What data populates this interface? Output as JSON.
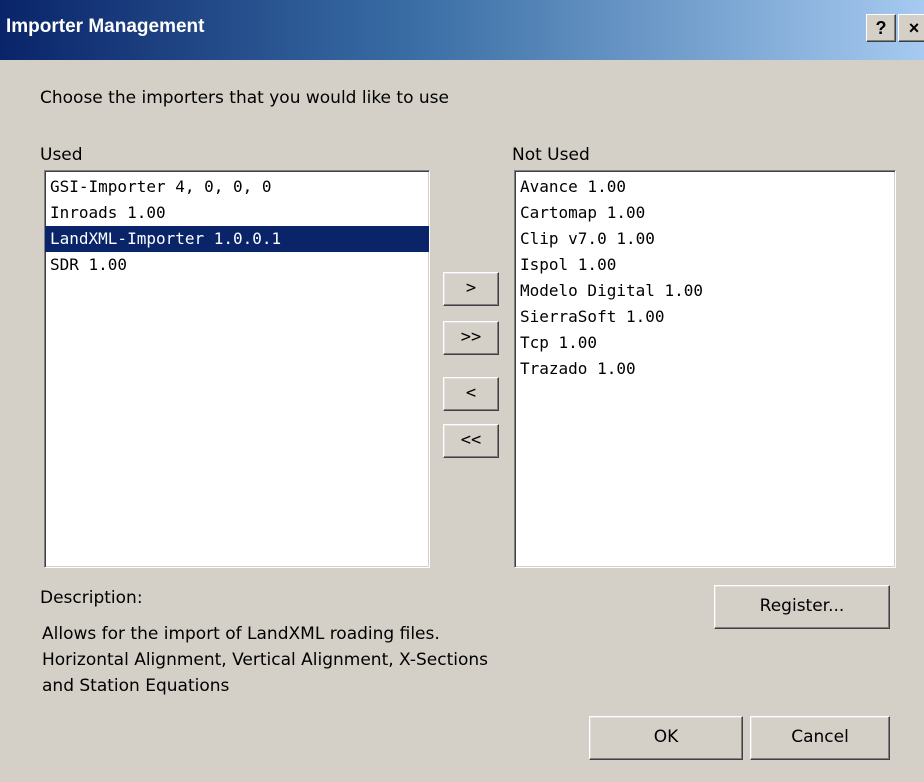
{
  "window": {
    "title": "Importer Management",
    "help_label": "?",
    "close_label": "×"
  },
  "instructions": "Choose the importers that you would like to use",
  "used": {
    "label": "Used",
    "items": [
      "GSI-Importer 4, 0, 0, 0",
      "Inroads 1.00",
      "LandXML-Importer 1.0.0.1",
      "SDR 1.00"
    ],
    "selected_index": 2
  },
  "not_used": {
    "label": "Not Used",
    "items": [
      "Avance 1.00",
      "Cartomap 1.00",
      "Clip v7.0 1.00",
      "Ispol 1.00",
      "Modelo Digital 1.00",
      "SierraSoft 1.00",
      "Tcp 1.00",
      "Trazado 1.00"
    ]
  },
  "move_buttons": {
    "add": ">",
    "add_all": ">>",
    "remove": "<",
    "remove_all": "<<"
  },
  "description": {
    "label": "Description:",
    "lines": [
      "Allows for the import of LandXML roading files.",
      "Horizontal Alignment, Vertical Alignment, X-Sections",
      "and Station Equations"
    ]
  },
  "buttons": {
    "register": "Register...",
    "ok": "OK",
    "cancel": "Cancel"
  },
  "colors": {
    "titlebar_start": "#0a246a",
    "titlebar_end": "#a6caf0",
    "selection": "#0a246a",
    "face": "#d4d0c8"
  }
}
